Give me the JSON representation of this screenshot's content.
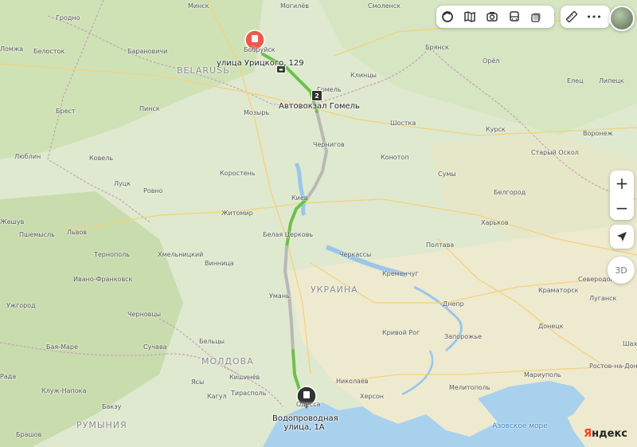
{
  "cities": [
    {
      "label": "Минск"
    },
    {
      "label": "Могилёв"
    },
    {
      "label": "Смоленск"
    },
    {
      "label": "Гродно"
    },
    {
      "label": "Белосток"
    },
    {
      "label": "Барановичи"
    },
    {
      "label": "Бобруйск"
    },
    {
      "label": "Брянск"
    },
    {
      "label": "Орёл"
    },
    {
      "label": "Клинцы"
    },
    {
      "label": "Ломжа"
    },
    {
      "label": "Гомель"
    },
    {
      "label": "Брест"
    },
    {
      "label": "Пинск"
    },
    {
      "label": "Мозырь"
    },
    {
      "label": "Курск"
    },
    {
      "label": "Елец"
    },
    {
      "label": "Липецк"
    },
    {
      "label": "Шостка"
    },
    {
      "label": "Воронеж"
    },
    {
      "label": "Старый Оскол"
    },
    {
      "label": "Люблин"
    },
    {
      "label": "Ковель"
    },
    {
      "label": "Чернигов"
    },
    {
      "label": "Конотоп"
    },
    {
      "label": "Сумы"
    },
    {
      "label": "Коростень"
    },
    {
      "label": "Белгород"
    },
    {
      "label": "Луцк"
    },
    {
      "label": "Ровно"
    },
    {
      "label": "Киев"
    },
    {
      "label": "Харьков"
    },
    {
      "label": "Жешув"
    },
    {
      "label": "Житомир"
    },
    {
      "label": "Львов"
    },
    {
      "label": "Белая Церковь"
    },
    {
      "label": "Пшемысль"
    },
    {
      "label": "Полтава"
    },
    {
      "label": "Тернополь"
    },
    {
      "label": "Хмельницкий"
    },
    {
      "label": "Черкассы"
    },
    {
      "label": "Кременчуг"
    },
    {
      "label": "Винница"
    },
    {
      "label": "Ивано-Франковск"
    },
    {
      "label": "Северодонецк"
    },
    {
      "label": "Умань"
    },
    {
      "label": "Краматорск"
    },
    {
      "label": "Ужгород"
    },
    {
      "label": "Черновцы"
    },
    {
      "label": "Луганск"
    },
    {
      "label": "Днепр"
    },
    {
      "label": "Кривой Рог"
    },
    {
      "label": "Запорожье"
    },
    {
      "label": "Донецк"
    },
    {
      "label": "Бая-Маре"
    },
    {
      "label": "Сучава"
    },
    {
      "label": "Бельцы"
    },
    {
      "label": "Шахт"
    },
    {
      "label": "Кишинёв"
    },
    {
      "label": "Ростов-на-Дону"
    },
    {
      "label": "Николаев"
    },
    {
      "label": "Мариуполь"
    },
    {
      "label": "Рада"
    },
    {
      "label": "Кагул"
    },
    {
      "label": "Мелитополь"
    },
    {
      "label": "Ясы"
    },
    {
      "label": "Клуж-Напока"
    },
    {
      "label": "Тирасполь"
    },
    {
      "label": "Херсон"
    },
    {
      "label": "Бакэу"
    },
    {
      "label": "Одесса"
    },
    {
      "label": "Брашов"
    }
  ],
  "countries": [
    {
      "label": "BELARUSЬ"
    },
    {
      "label": "УКРАИНА"
    },
    {
      "label": "МОЛДОВА"
    },
    {
      "label": "РУМЫНИЯ"
    }
  ],
  "seas": [
    {
      "label": "Азовское море"
    }
  ],
  "route": {
    "start_label": "улица Урицкого, 129",
    "waypoint_label": "Автовокзал Гомель",
    "end_label": "Водопроводная улица, 1А",
    "waypoint_badge": "2",
    "colors": {
      "traffic_free": "#6cc04a",
      "no_data": "#b8b8b8",
      "start_pin": "#f0574a",
      "end_pin": "#333333"
    }
  },
  "toolbar": {
    "icons": [
      "layers-icon",
      "map-icon",
      "camera-icon",
      "bus-icon",
      "panorama-icon"
    ],
    "ruler_icon": "ruler-icon",
    "more_label": "•••"
  },
  "controls": {
    "zoom_in": "+",
    "zoom_out": "−",
    "btn3d": "3D"
  },
  "logo": {
    "first": "Я",
    "rest": "ндекс"
  }
}
